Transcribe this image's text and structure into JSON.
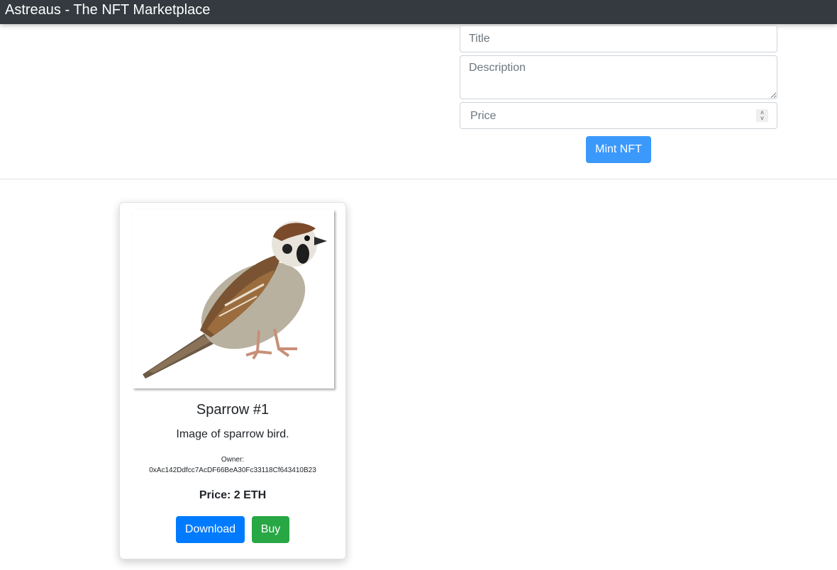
{
  "navbar": {
    "brand": "Astreaus - The NFT Marketplace"
  },
  "mint_form": {
    "title_placeholder": "Title",
    "description_placeholder": "Description",
    "price_placeholder": "Price",
    "mint_button_label": "Mint NFT"
  },
  "nft_cards": [
    {
      "image_icon": "sparrow-bird-image",
      "title": "Sparrow #1",
      "description": "Image of sparrow bird.",
      "owner_label": "Owner:",
      "owner_address": "0xAc142Ddfcc7AcDF66BeA30Fc33118Cf643410B23",
      "price": "Price: 2 ETH",
      "download_label": "Download",
      "buy_label": "Buy"
    }
  ],
  "colors": {
    "navbar": "#343a40",
    "mint_button": "#3b99fc",
    "download_button": "#007bff",
    "buy_button": "#28a745"
  }
}
